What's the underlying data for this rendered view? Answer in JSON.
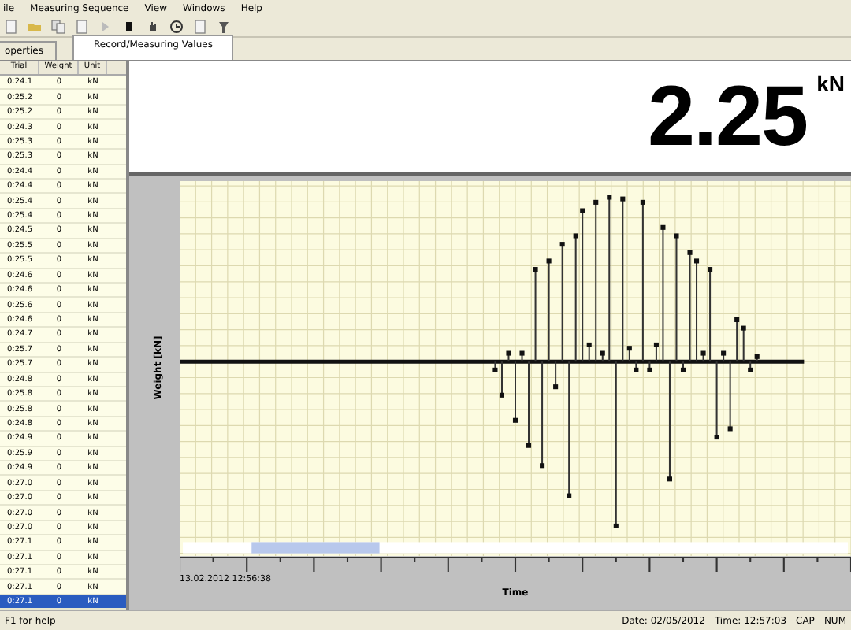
{
  "menu": [
    "ile",
    "Measuring Sequence",
    "View",
    "Windows",
    "Help"
  ],
  "tabs": [
    {
      "label": "operties",
      "selected": false
    },
    {
      "label": "Record/Measuring Values",
      "selected": true
    }
  ],
  "table": {
    "columns": [
      "Trial",
      "Weight",
      "Unit"
    ],
    "rows": [
      {
        "cells": [
          "0:24.1",
          "0",
          "kN"
        ],
        "selected": false
      },
      {
        "cells": [
          "0:25.2",
          "0",
          "kN"
        ],
        "selected": false
      },
      {
        "cells": [
          "0:25.2",
          "0",
          "kN"
        ],
        "selected": false
      },
      {
        "cells": [
          "0:24.3",
          "0",
          "kN"
        ],
        "selected": false
      },
      {
        "cells": [
          "0:25.3",
          "0",
          "kN"
        ],
        "selected": false
      },
      {
        "cells": [
          "0:25.3",
          "0",
          "kN"
        ],
        "selected": false
      },
      {
        "cells": [
          "0:24.4",
          "0",
          "kN"
        ],
        "selected": false
      },
      {
        "cells": [
          "0:24.4",
          "0",
          "kN"
        ],
        "selected": false
      },
      {
        "cells": [
          "0:25.4",
          "0",
          "kN"
        ],
        "selected": false
      },
      {
        "cells": [
          "0:25.4",
          "0",
          "kN"
        ],
        "selected": false
      },
      {
        "cells": [
          "0:24.5",
          "0",
          "kN"
        ],
        "selected": false
      },
      {
        "cells": [
          "0:25.5",
          "0",
          "kN"
        ],
        "selected": false
      },
      {
        "cells": [
          "0:25.5",
          "0",
          "kN"
        ],
        "selected": false
      },
      {
        "cells": [
          "0:24.6",
          "0",
          "kN"
        ],
        "selected": false
      },
      {
        "cells": [
          "0:24.6",
          "0",
          "kN"
        ],
        "selected": false
      },
      {
        "cells": [
          "0:25.6",
          "0",
          "kN"
        ],
        "selected": false
      },
      {
        "cells": [
          "0:24.6",
          "0",
          "kN"
        ],
        "selected": false
      },
      {
        "cells": [
          "0:24.7",
          "0",
          "kN"
        ],
        "selected": false
      },
      {
        "cells": [
          "0:25.7",
          "0",
          "kN"
        ],
        "selected": false
      },
      {
        "cells": [
          "0:25.7",
          "0",
          "kN"
        ],
        "selected": false
      },
      {
        "cells": [
          "0:24.8",
          "0",
          "kN"
        ],
        "selected": false
      },
      {
        "cells": [
          "0:25.8",
          "0",
          "kN"
        ],
        "selected": false
      },
      {
        "cells": [
          "0:25.8",
          "0",
          "kN"
        ],
        "selected": false
      },
      {
        "cells": [
          "0:24.8",
          "0",
          "kN"
        ],
        "selected": false
      },
      {
        "cells": [
          "0:24.9",
          "0",
          "kN"
        ],
        "selected": false
      },
      {
        "cells": [
          "0:25.9",
          "0",
          "kN"
        ],
        "selected": false
      },
      {
        "cells": [
          "0:24.9",
          "0",
          "kN"
        ],
        "selected": false
      },
      {
        "cells": [
          "0:27.0",
          "0",
          "kN"
        ],
        "selected": false
      },
      {
        "cells": [
          "0:27.0",
          "0",
          "kN"
        ],
        "selected": false
      },
      {
        "cells": [
          "0:27.0",
          "0",
          "kN"
        ],
        "selected": false
      },
      {
        "cells": [
          "0:27.0",
          "0",
          "kN"
        ],
        "selected": false
      },
      {
        "cells": [
          "0:27.1",
          "0",
          "kN"
        ],
        "selected": false
      },
      {
        "cells": [
          "0:27.1",
          "0",
          "kN"
        ],
        "selected": false
      },
      {
        "cells": [
          "0:27.1",
          "0",
          "kN"
        ],
        "selected": false
      },
      {
        "cells": [
          "0:27.1",
          "0",
          "kN"
        ],
        "selected": false
      },
      {
        "cells": [
          "0:27.1",
          "0",
          "kN"
        ],
        "selected": true
      }
    ]
  },
  "reading": {
    "value": "2.25",
    "unit": "kN"
  },
  "chart": {
    "ylabel": "Weight [kN]",
    "xlabel": "Time",
    "timestamp": "13.02.2012 12:56:38"
  },
  "status_bar": {
    "hint": "F1 for help",
    "date": "Date: 02/05/2012",
    "time": "Time: 12:57:03",
    "indicators": [
      "CAP",
      "NUM"
    ]
  }
}
